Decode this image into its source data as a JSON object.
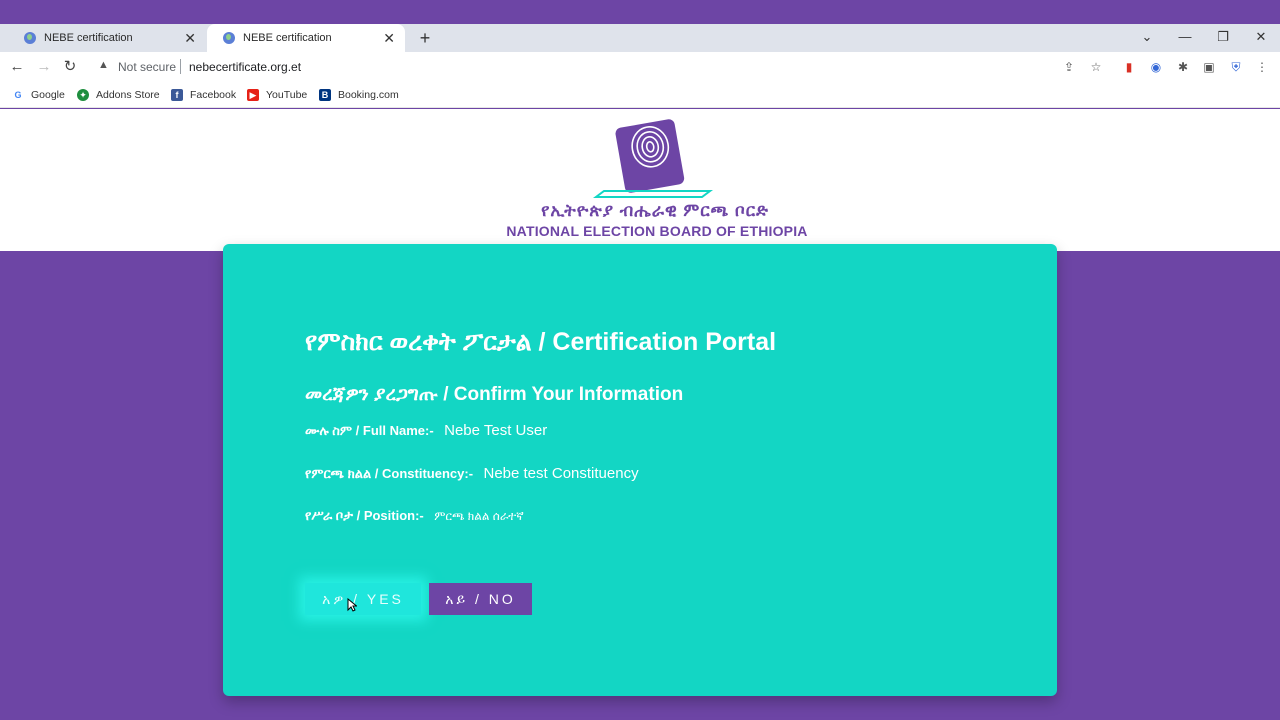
{
  "browser": {
    "tabs": [
      {
        "title": "NEBE certification"
      },
      {
        "title": "NEBE certification"
      }
    ],
    "new_tab": "+",
    "security_label": "Not secure",
    "url": "nebecertificate.org.et",
    "bookmarks": [
      {
        "label": "Google",
        "icon": "google-icon",
        "color": "#4285f4"
      },
      {
        "label": "Addons Store",
        "icon": "addons-store-icon",
        "color": "#1e8e3e"
      },
      {
        "label": "Facebook",
        "icon": "facebook-icon",
        "color": "#3b5998"
      },
      {
        "label": "YouTube",
        "icon": "youtube-icon",
        "color": "#e62117"
      },
      {
        "label": "Booking.com",
        "icon": "booking-icon",
        "color": "#003580"
      }
    ]
  },
  "header": {
    "org_amharic": "የኢትዮጵያ ብሔራዊ ምርጫ ቦርድ",
    "org_english": "NATIONAL ELECTION BOARD OF ETHIOPIA"
  },
  "card": {
    "portal_title": "የምስክር ወረቀት ፖርታል / Certification Portal",
    "confirm_title": "መረጃዎን ያረጋግጡ / Confirm Your Information",
    "full_name_label": "ሙሉ ስም / Full Name:-",
    "full_name_value": "Nebe Test User",
    "constituency_label": "የምርጫ ክልል / Constituency:-",
    "constituency_value": "Nebe test Constituency",
    "position_label": "የሥራ ቦታ / Position:-",
    "position_value": "ምርጫ ክልል ሰራተኛ",
    "yes_label": "አዎ / YES",
    "no_label": "አይ / NO"
  },
  "colors": {
    "brand_purple": "#6d45a5",
    "card_teal": "#13d6c4",
    "yes_button": "#1fe6dc"
  }
}
